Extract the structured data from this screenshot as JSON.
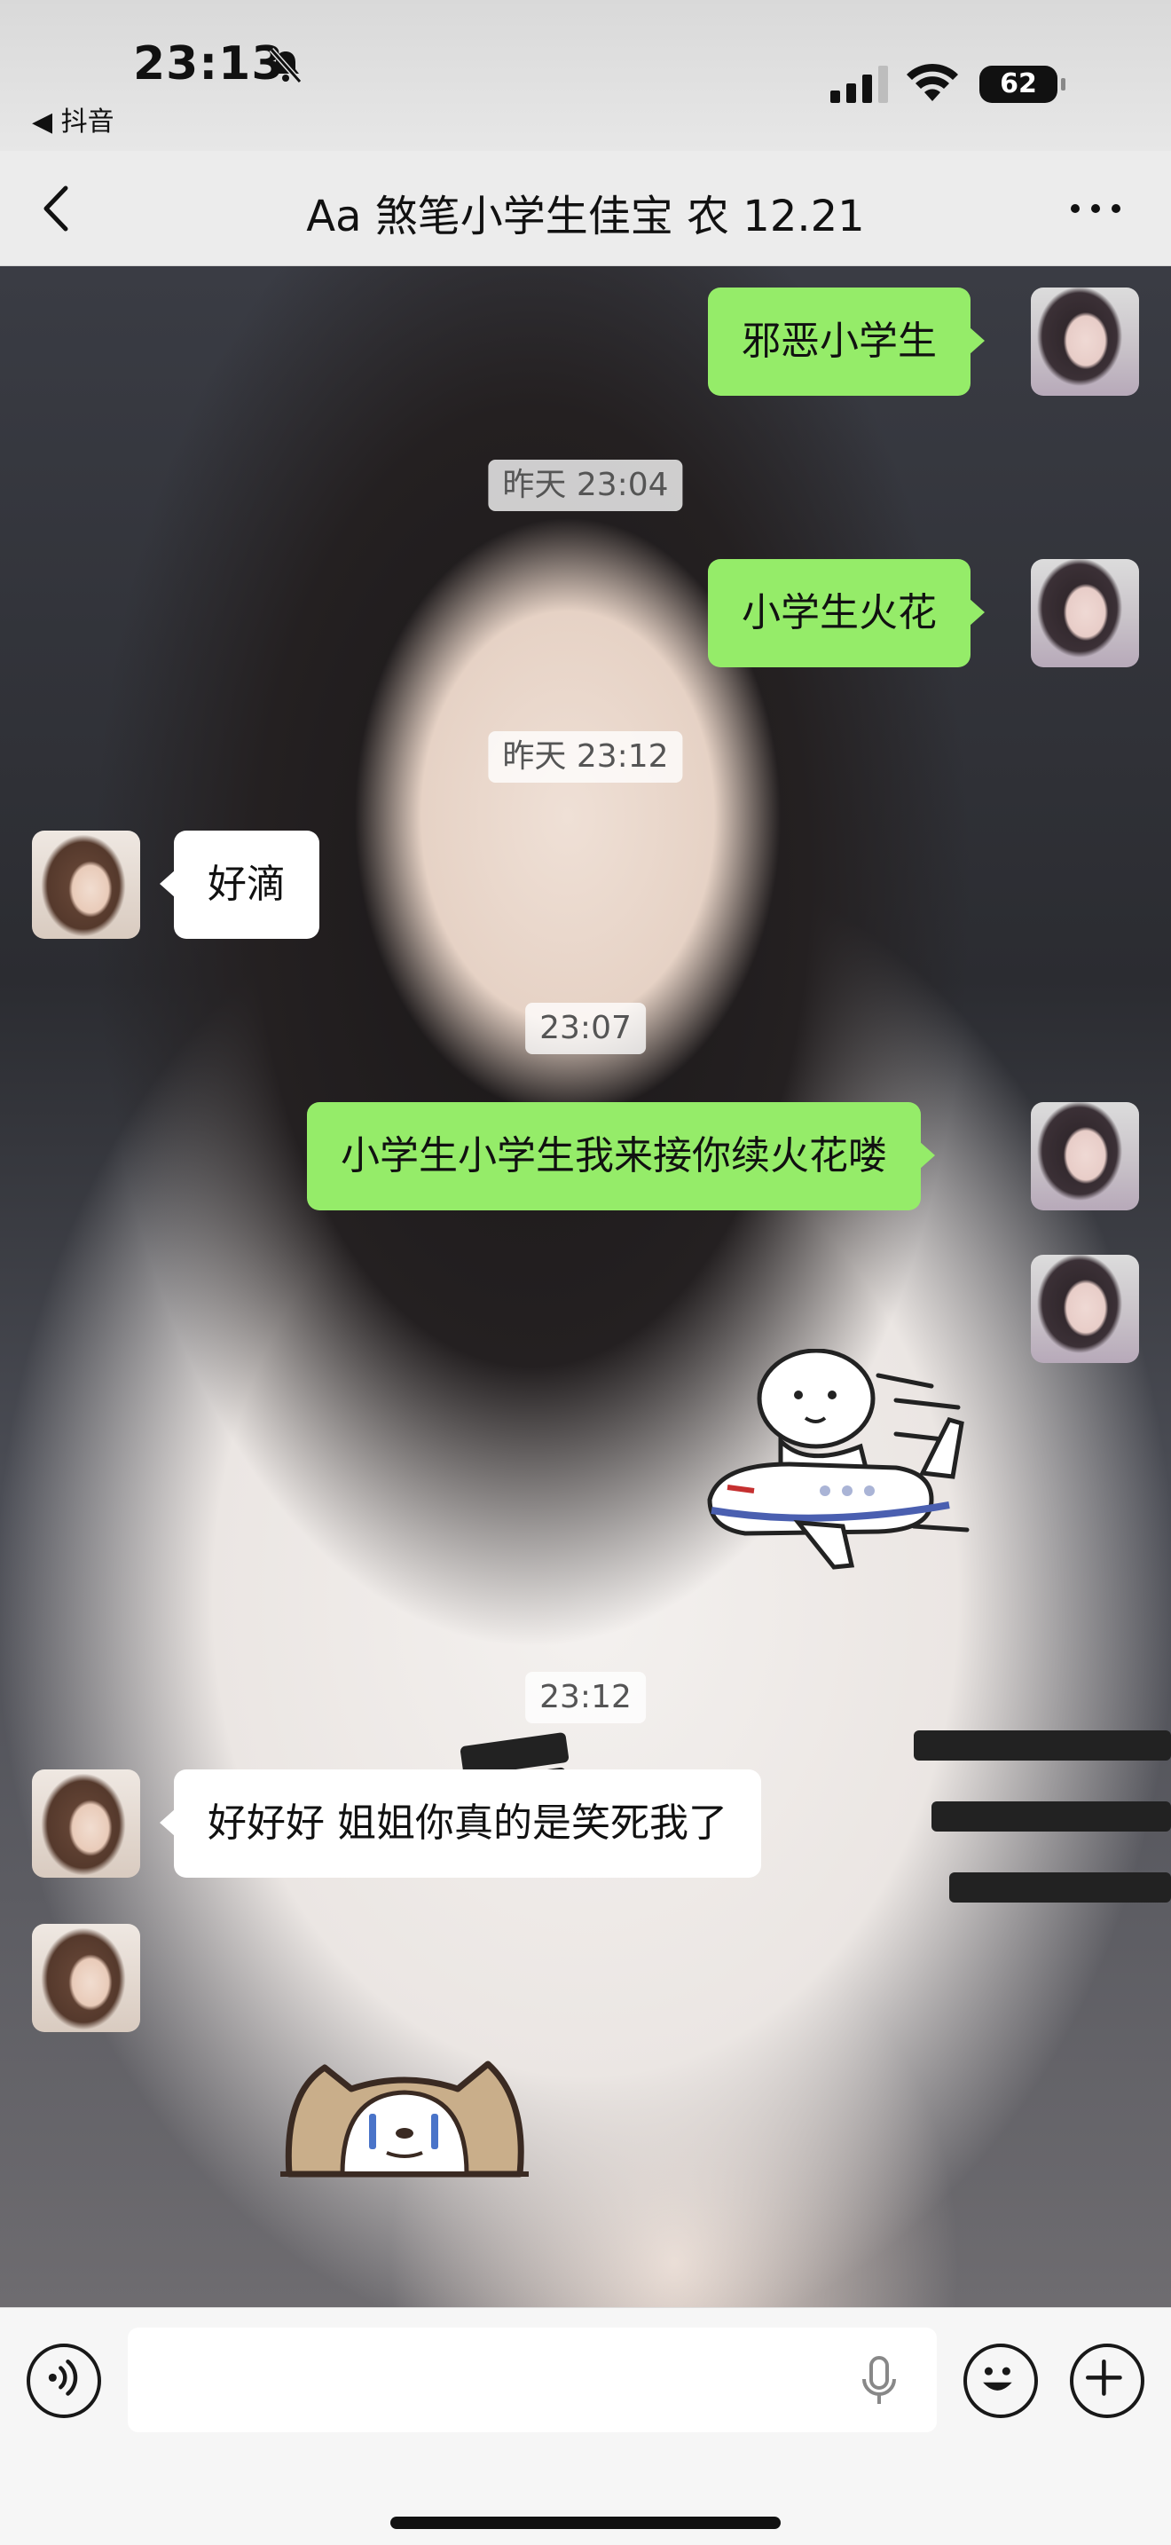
{
  "status_bar": {
    "time": "23:13",
    "back_app": "◀ 抖音",
    "battery": "62",
    "icons": [
      "bell-mute-icon",
      "signal-icon",
      "wifi-icon",
      "battery-icon"
    ]
  },
  "header": {
    "title": "Aa 煞笔小学生佳宝 农 12.21",
    "back_icon": "chevron-left-icon",
    "more_icon": "more-dots-icon"
  },
  "messages": [
    {
      "type": "text",
      "side": "right",
      "text": "邪恶小学生"
    },
    {
      "type": "time",
      "text": "昨天 23:04"
    },
    {
      "type": "text",
      "side": "right",
      "text": "小学生火花"
    },
    {
      "type": "time",
      "text": "昨天 23:12"
    },
    {
      "type": "text",
      "side": "left",
      "text": "好滴"
    },
    {
      "type": "time",
      "text": "23:07"
    },
    {
      "type": "text",
      "side": "right",
      "text": "小学生小学生我来接你续火花喽"
    },
    {
      "type": "sticker",
      "side": "right",
      "sticker": "airplane-rider-sticker"
    },
    {
      "type": "time",
      "text": "23:12"
    },
    {
      "type": "text",
      "side": "left",
      "text": "好好好 姐姐你真的是笑死我了"
    },
    {
      "type": "sticker",
      "side": "left",
      "sticker": "crying-cat-sticker"
    }
  ],
  "input_bar": {
    "value": "",
    "placeholder": "",
    "icons": [
      "voice-icon",
      "microphone-icon",
      "emoji-icon",
      "plus-icon"
    ]
  },
  "colors": {
    "self_bubble": "#95ec69",
    "other_bubble": "#ffffff",
    "header_bg": "#ececec",
    "input_bg": "#f6f6f6"
  }
}
